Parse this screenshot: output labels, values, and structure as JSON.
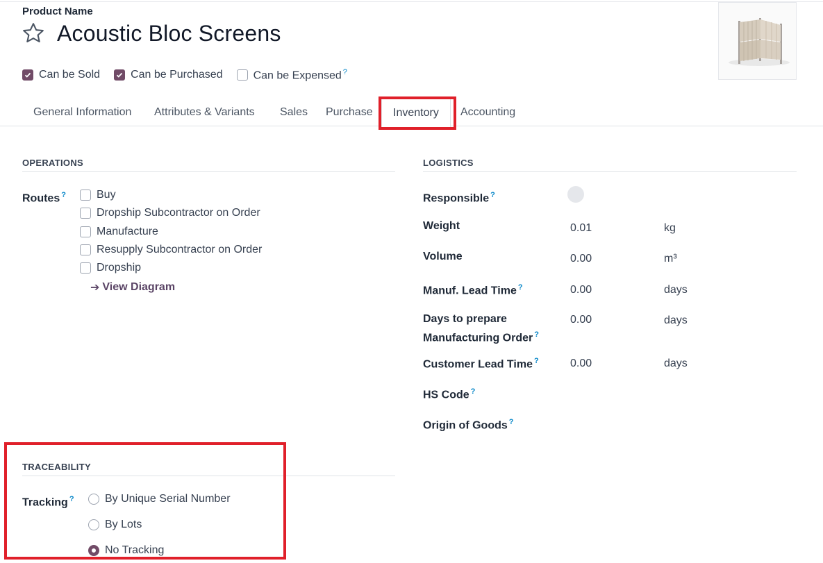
{
  "product": {
    "name_label": "Product Name",
    "name": "Acoustic Bloc Screens",
    "flags": [
      {
        "label": "Can be Sold",
        "checked": true
      },
      {
        "label": "Can be Purchased",
        "checked": true
      },
      {
        "label": "Can be Expensed",
        "checked": false,
        "help": "?"
      }
    ]
  },
  "tabs": [
    {
      "label": "General Information"
    },
    {
      "label": "Attributes & Variants"
    },
    {
      "label": "Sales"
    },
    {
      "label": "Purchase"
    },
    {
      "label": "Inventory",
      "active": true
    },
    {
      "label": "Accounting"
    }
  ],
  "operations": {
    "title": "OPERATIONS",
    "routes_label": "Routes",
    "routes_help": "?",
    "routes": [
      {
        "label": "Buy",
        "checked": false
      },
      {
        "label": "Dropship Subcontractor on Order",
        "checked": false
      },
      {
        "label": "Manufacture",
        "checked": false
      },
      {
        "label": "Resupply Subcontractor on Order",
        "checked": false
      },
      {
        "label": "Dropship",
        "checked": false
      }
    ],
    "view_diagram": "View Diagram"
  },
  "logistics": {
    "title": "LOGISTICS",
    "responsible": {
      "label": "Responsible",
      "help": "?"
    },
    "weight": {
      "label": "Weight",
      "value": "0.01",
      "unit": "kg"
    },
    "volume": {
      "label": "Volume",
      "value": "0.00",
      "unit": "m³"
    },
    "manuf_lead_time": {
      "label": "Manuf. Lead Time",
      "help": "?",
      "value": "0.00",
      "unit": "days"
    },
    "days_prepare": {
      "label_line1": "Days to prepare",
      "label_line2": "Manufacturing Order",
      "help": "?",
      "value": "0.00",
      "unit": "days"
    },
    "customer_lead_time": {
      "label": "Customer Lead Time",
      "help": "?",
      "value": "0.00",
      "unit": "days"
    },
    "hs_code": {
      "label": "HS Code",
      "help": "?"
    },
    "origin": {
      "label": "Origin of Goods",
      "help": "?"
    }
  },
  "traceability": {
    "title": "TRACEABILITY",
    "tracking_label": "Tracking",
    "tracking_help": "?",
    "options": [
      {
        "label": "By Unique Serial Number",
        "selected": false
      },
      {
        "label": "By Lots",
        "selected": false
      },
      {
        "label": "No Tracking",
        "selected": true
      }
    ]
  },
  "colors": {
    "accent": "#714b67",
    "highlight": "#e0202a",
    "help": "#0284c7"
  }
}
